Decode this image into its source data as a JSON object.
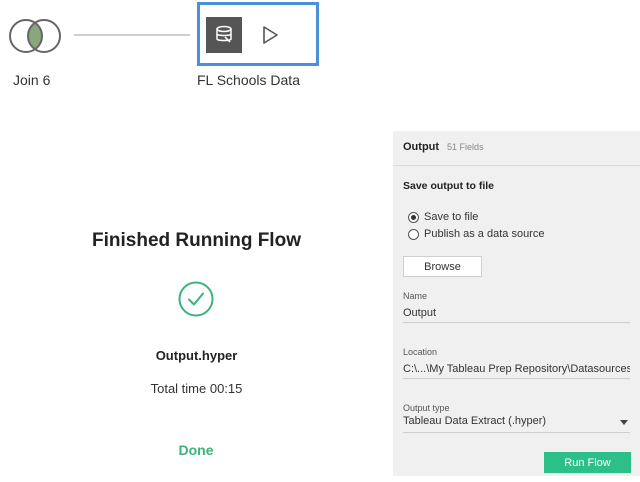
{
  "flow": {
    "join_label": "Join 6",
    "output_label": "FL Schools Data"
  },
  "finish": {
    "title": "Finished Running Flow",
    "file_name": "Output.hyper",
    "total_time": "Total time 00:15",
    "done_label": "Done"
  },
  "panel": {
    "title": "Output",
    "fields": "51 Fields",
    "section_title": "Save output to file",
    "options": [
      {
        "label": "Save to file",
        "selected": true
      },
      {
        "label": "Publish as a data source",
        "selected": false
      }
    ],
    "browse_label": "Browse",
    "name_label": "Name",
    "name_value": "Output",
    "location_label": "Location",
    "location_value": "C:\\...\\My Tableau Prep Repository\\Datasources",
    "output_type_label": "Output type",
    "output_type_value": "Tableau Data Extract (.hyper)",
    "run_label": "Run Flow"
  },
  "colors": {
    "node_border": "#4a90d9",
    "join_fill": "#8aa67d",
    "accent_green": "#2dbf8a",
    "done_green": "#3bb37a"
  }
}
